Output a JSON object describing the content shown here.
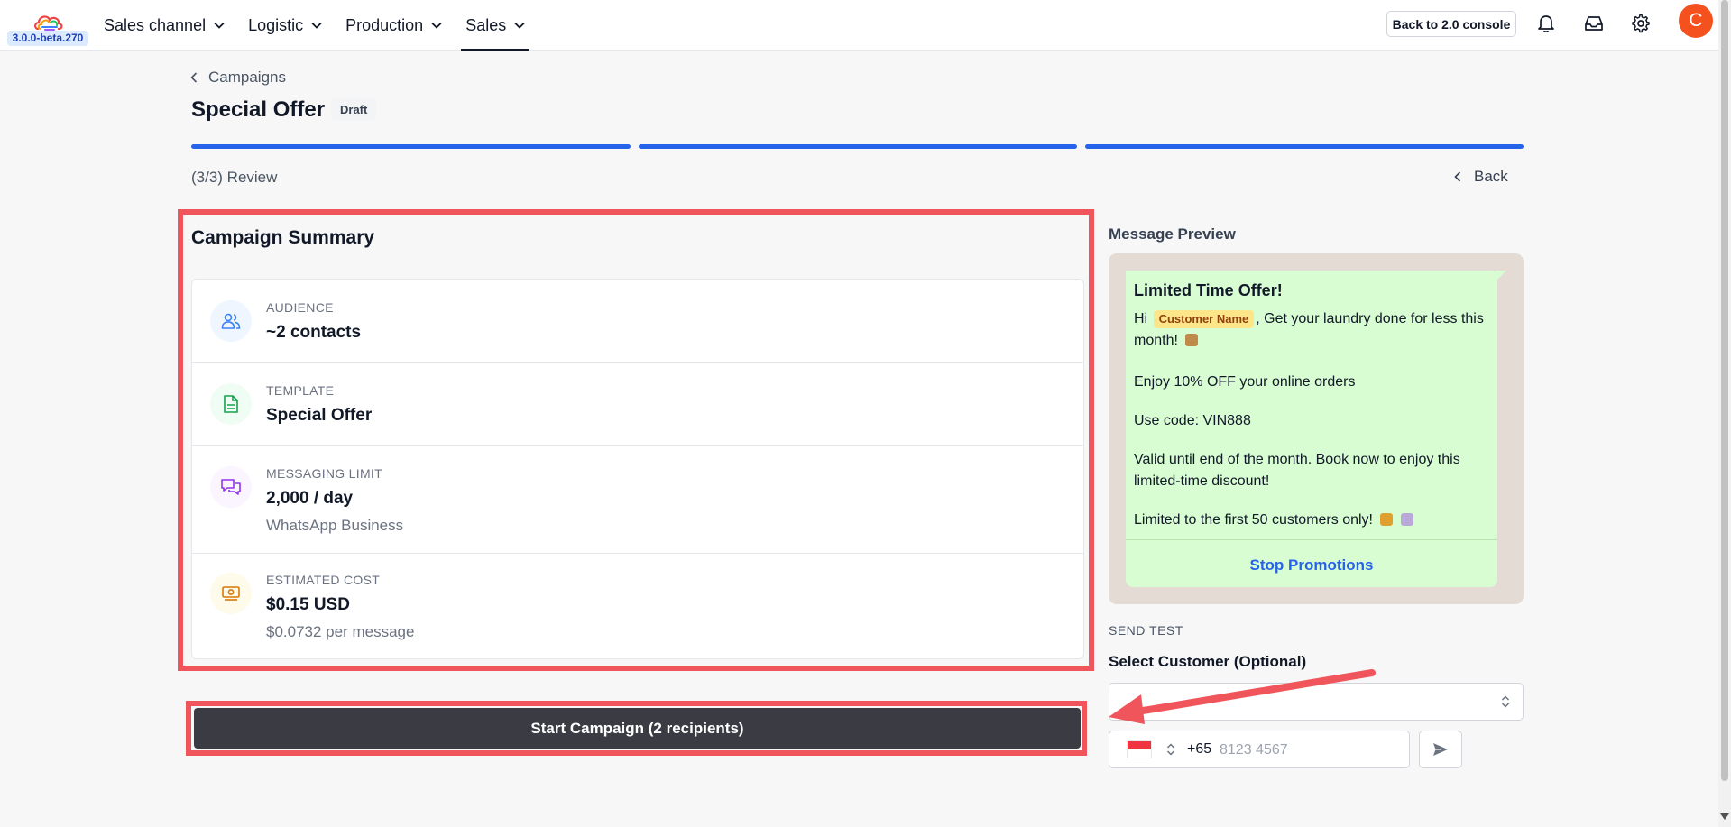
{
  "app": {
    "version": "3.0.0-beta.270",
    "brand_colors": [
      "#ef4444",
      "#f59e0b",
      "#22c55e",
      "#3b82f6",
      "#a855f7"
    ]
  },
  "nav": {
    "items": [
      {
        "label": "Sales channel",
        "active": false
      },
      {
        "label": "Logistic",
        "active": false
      },
      {
        "label": "Production",
        "active": false
      },
      {
        "label": "Sales",
        "active": true
      }
    ],
    "console_button": "Back to 2.0 console",
    "icons": [
      "bell-icon",
      "inbox-icon",
      "gear-icon"
    ],
    "avatar_initial": "C",
    "avatar_color": "#f4511e"
  },
  "header": {
    "breadcrumb": "Campaigns",
    "title": "Special Offer",
    "badge": "Draft",
    "step_label": "(3/3) Review",
    "back_label": "Back",
    "progress_color": "#2563eb"
  },
  "summary": {
    "title": "Campaign Summary",
    "rows": [
      {
        "label": "AUDIENCE",
        "value": "~2 contacts",
        "sub": "",
        "icon": "users-icon",
        "icon_color": "#3b82f6",
        "icon_bg": "#eff6ff"
      },
      {
        "label": "TEMPLATE",
        "value": "Special Offer",
        "sub": "",
        "icon": "document-icon",
        "icon_color": "#16a34a",
        "icon_bg": "#f0fdf4"
      },
      {
        "label": "MESSAGING LIMIT",
        "value": "2,000 / day",
        "sub": "WhatsApp Business",
        "icon": "chat-bubbles-icon",
        "icon_color": "#9333ea",
        "icon_bg": "#faf5ff"
      },
      {
        "label": "ESTIMATED COST",
        "value": "$0.15 USD",
        "sub": "$0.0732 per message",
        "icon": "money-icon",
        "icon_color": "#d97706",
        "icon_bg": "#fffbeb"
      }
    ]
  },
  "actions": {
    "start_button": "Start Campaign (2 recipients)"
  },
  "preview": {
    "title": "Message Preview",
    "message_title": "Limited Time Offer!",
    "greeting": "Hi",
    "customer_chip": "Customer Name",
    "line1_rest": ", Get your laundry done for less this month!",
    "line2": "Enjoy 10% OFF your online orders",
    "line3": "Use code: VIN888",
    "line4": "Valid until end of the month. Book now to enjoy this limited-time discount!",
    "line5": "Limited to the first 50 customers only!",
    "stop_link": "Stop Promotions",
    "bubble_color": "#d9fdd3",
    "background_color": "#e4dcd4"
  },
  "send_test": {
    "section_label": "SEND TEST",
    "select_label": "Select Customer (Optional)",
    "dial_code": "+65",
    "phone_placeholder": "8123 4567"
  },
  "annotation_color": "#f0555b"
}
